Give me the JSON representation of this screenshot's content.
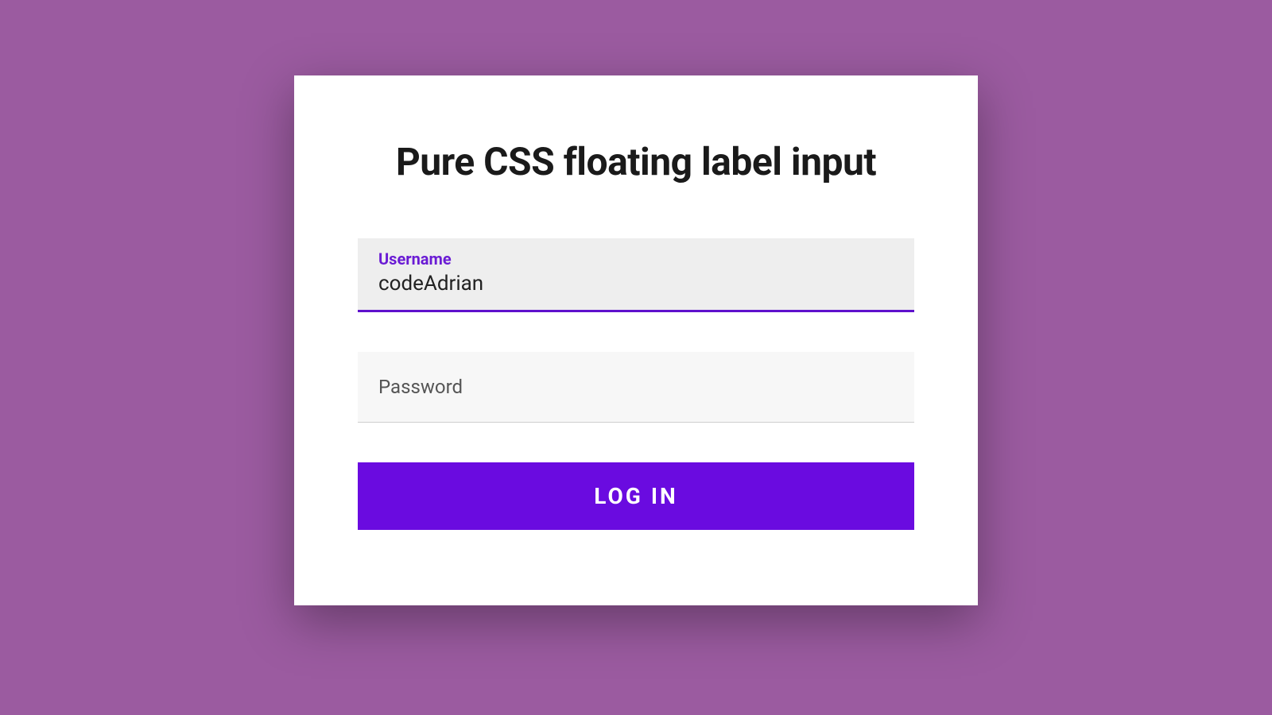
{
  "form": {
    "title": "Pure CSS floating label input",
    "username": {
      "label": "Username",
      "value": "codeAdrian"
    },
    "password": {
      "label": "Password",
      "value": ""
    },
    "submit_label": "LOG IN"
  }
}
